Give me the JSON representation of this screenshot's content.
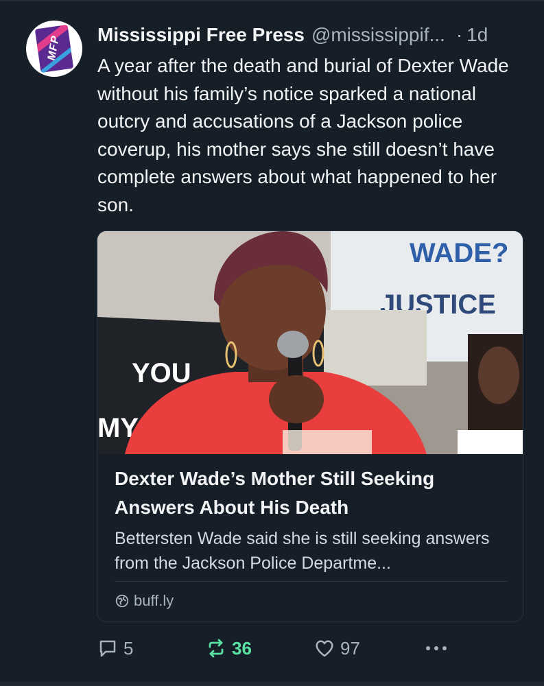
{
  "post": {
    "author_name": "Mississippi Free Press",
    "handle": "@mississippif...",
    "separator": "·",
    "time": "1d",
    "avatar_text": "MFP",
    "text": "A year after the death and burial of Dexter Wade without his family’s notice sparked a national outcry and accusations of a Jackson police coverup, his mother says she still doesn’t have complete answers about what happened to her son."
  },
  "link_card": {
    "image_sign_text_1": "WADE?",
    "image_sign_text_2": "JUSTICE",
    "image_sign_text_3": "YOU",
    "image_sign_text_4": "MY",
    "title": "Dexter Wade’s Mother Still Seeking Answers About His Death",
    "description": "Bettersten Wade said she is still seeking answers from the Jackson Police Departme...",
    "domain": "buff.ly"
  },
  "actions": {
    "reply_count": "5",
    "repost_count": "36",
    "like_count": "97"
  },
  "colors": {
    "background": "#161e27",
    "text": "#f1f3f5",
    "muted": "#aab4c0",
    "repost_active": "#5be0a4",
    "brand_purple": "#5b2a91"
  },
  "icons": [
    "reply-icon",
    "repost-icon",
    "heart-icon",
    "more-icon",
    "globe-icon"
  ]
}
